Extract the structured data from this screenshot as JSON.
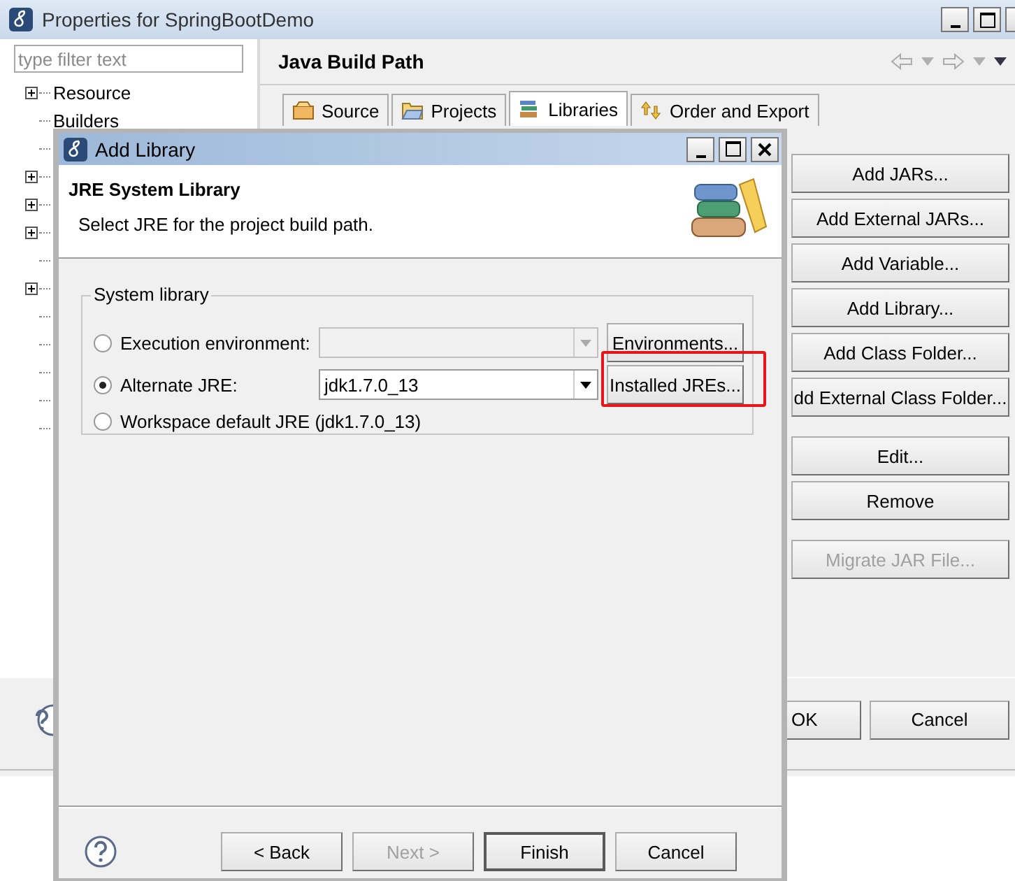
{
  "window": {
    "title": "Properties for SpringBootDemo"
  },
  "filter": {
    "placeholder": "type filter text"
  },
  "tree": [
    {
      "label": "Resource",
      "expandable": true
    },
    {
      "label": "Builders",
      "expandable": false
    }
  ],
  "covered_tree_rows": [
    {
      "expandable": false
    },
    {
      "expandable": true
    },
    {
      "expandable": true
    },
    {
      "expandable": true
    },
    {
      "expandable": false
    },
    {
      "expandable": true
    },
    {
      "expandable": false
    },
    {
      "expandable": false
    },
    {
      "expandable": false
    },
    {
      "expandable": false
    },
    {
      "expandable": false
    }
  ],
  "page": {
    "title": "Java Build Path",
    "tabs": [
      {
        "label": "Source",
        "selected": false
      },
      {
        "label": "Projects",
        "selected": false
      },
      {
        "label": "Libraries",
        "selected": true
      },
      {
        "label": "Order and Export",
        "selected": false
      }
    ],
    "button_groups": [
      [
        {
          "label": "Add JARs...",
          "disabled": false
        },
        {
          "label": "Add External JARs...",
          "disabled": false
        },
        {
          "label": "Add Variable...",
          "disabled": false
        },
        {
          "label": "Add Library...",
          "disabled": false
        },
        {
          "label": "Add Class Folder...",
          "disabled": false
        },
        {
          "label": "dd External Class Folder...",
          "disabled": false
        }
      ],
      [
        {
          "label": "Edit...",
          "disabled": false
        },
        {
          "label": "Remove",
          "disabled": false
        }
      ],
      [
        {
          "label": "Migrate JAR File...",
          "disabled": true
        }
      ]
    ]
  },
  "footer": {
    "buttons": [
      {
        "label": "OK"
      },
      {
        "label": "Cancel"
      }
    ]
  },
  "dialog": {
    "title": "Add Library",
    "heading": "JRE System Library",
    "description": "Select JRE for the project build path.",
    "group": {
      "title": "System library",
      "options": [
        {
          "label": "Execution environment:",
          "selected": false,
          "kind": "combo",
          "combo": {
            "disabled": true
          },
          "button": {
            "label": "Environments...",
            "highlighted": false
          }
        },
        {
          "label": "Alternate JRE:",
          "selected": true,
          "kind": "combo",
          "combo": {
            "value": "jdk1.7.0_13",
            "disabled": false
          },
          "button": {
            "label": "Installed JREs...",
            "highlighted": true
          }
        },
        {
          "label": "Workspace default JRE (jdk1.7.0_13)",
          "selected": false,
          "kind": "plain"
        }
      ]
    },
    "buttons": [
      {
        "label": "< Back",
        "disabled": false,
        "default": false
      },
      {
        "label": "Next >",
        "disabled": true,
        "default": false
      },
      {
        "label": "Finish",
        "disabled": false,
        "default": true
      },
      {
        "label": "Cancel",
        "disabled": false,
        "default": false
      }
    ]
  }
}
